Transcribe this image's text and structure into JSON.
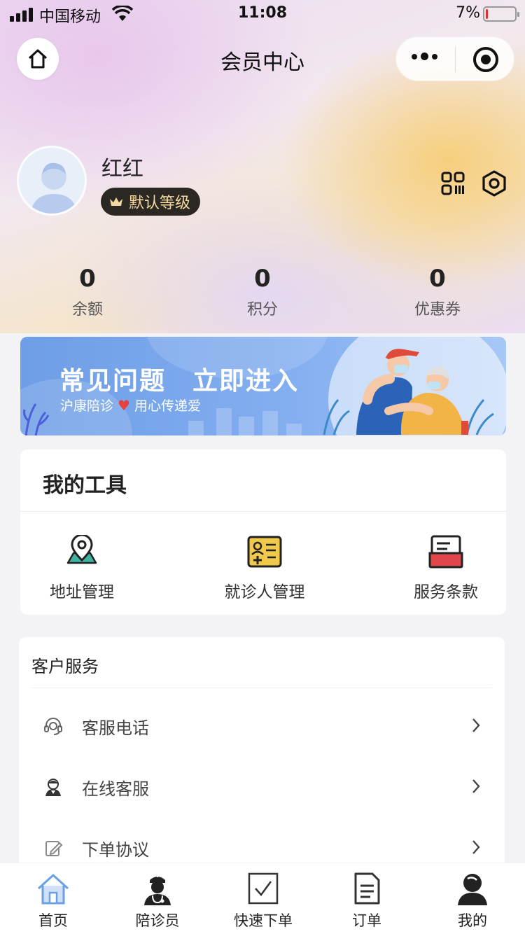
{
  "status_bar": {
    "carrier": "中国移动",
    "time": "11:08",
    "battery": "7%",
    "battery_level": 0.07
  },
  "nav": {
    "title": "会员中心"
  },
  "profile": {
    "name": "红红",
    "level": "默认等级"
  },
  "stats": [
    {
      "value": "0",
      "label": "余额"
    },
    {
      "value": "0",
      "label": "积分"
    },
    {
      "value": "0",
      "label": "优惠券"
    }
  ],
  "banner": {
    "title": "常见问题　立即进入",
    "subtitle_left": "沪康陪诊",
    "subtitle_right": "用心传递爱"
  },
  "tools": {
    "title": "我的工具",
    "items": [
      {
        "label": "地址管理",
        "icon": "map-pin-icon"
      },
      {
        "label": "就诊人管理",
        "icon": "patient-card-icon"
      },
      {
        "label": "服务条款",
        "icon": "terms-icon"
      }
    ]
  },
  "service": {
    "title": "客户服务",
    "items": [
      {
        "label": "客服电话",
        "icon": "headset-icon"
      },
      {
        "label": "在线客服",
        "icon": "agent-icon"
      },
      {
        "label": "下单协议",
        "icon": "edit-icon"
      }
    ]
  },
  "tabbar": {
    "items": [
      {
        "label": "首页",
        "icon": "home-icon",
        "active": true
      },
      {
        "label": "陪诊员",
        "icon": "doctor-icon"
      },
      {
        "label": "快速下单",
        "icon": "check-box-icon"
      },
      {
        "label": "订单",
        "icon": "document-icon"
      },
      {
        "label": "我的",
        "icon": "user-icon"
      }
    ]
  },
  "colors": {
    "badge_bg": "#2b2723",
    "badge_text": "#f3d9a0",
    "banner": "#7aa8ec",
    "active_tab": "#6aa0e6"
  }
}
